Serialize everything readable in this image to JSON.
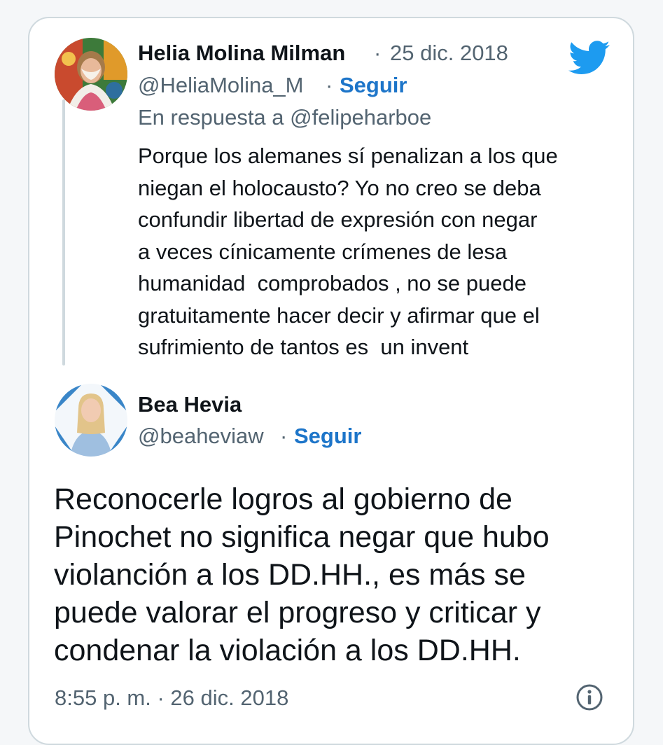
{
  "reply_tweet": {
    "author_name": "Helia Molina Milman",
    "separator": "·",
    "date": "25 dic. 2018",
    "handle": "@HeliaMolina_M",
    "follow_label": "Seguir",
    "reply_context": "En respuesta a @felipeharboe",
    "body_lines": [
      "Porque los alemanes sí penalizan a los que",
      "niegan el holocausto? Yo no creo se deba",
      "confundir libertad de expresión con negar",
      "a veces cínicamente crímenes de lesa",
      "humanidad  comprobados , no se puede",
      "gratuitamente hacer decir y afirmar que el",
      "sufrimiento de tantos es  un invent"
    ]
  },
  "main_tweet": {
    "author_name": "Bea Hevia",
    "handle": "@beaheviaw",
    "separator": "·",
    "follow_label": "Seguir",
    "body_lines": [
      "Reconocerle logros al gobierno de",
      "Pinochet no significa negar que hubo",
      "violanción a los DD.HH., es más se",
      "puede valorar el progreso y criticar y",
      "condenar la violación a los DD.HH."
    ],
    "timestamp": "8:55 p. m. · 26 dic. 2018"
  },
  "icons": {
    "brand": "twitter-bird-icon",
    "info": "info-icon"
  },
  "colors": {
    "accent": "#1d9bf0",
    "follow_link": "#1d75c9",
    "secondary_text": "#536471",
    "border": "#cfd9de"
  }
}
